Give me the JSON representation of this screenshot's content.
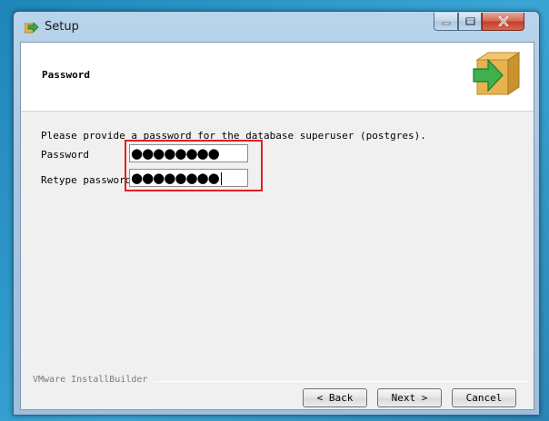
{
  "window": {
    "title": "Setup",
    "controls": {
      "minimize": "–",
      "maximize": "□",
      "close": "✕"
    }
  },
  "header": {
    "title": "Password"
  },
  "form": {
    "description": "Please provide a password for the database superuser (postgres).",
    "password_label": "Password",
    "password_value": "●●●●●●●●",
    "retype_label": "Retype password",
    "retype_value": "●●●●●●●●"
  },
  "footer": {
    "brand": "VMware InstallBuilder",
    "back_label": "< Back",
    "next_label": "Next >",
    "cancel_label": "Cancel"
  },
  "colors": {
    "highlight": "#e02020",
    "titlebar": "#a7c6e2",
    "client_bg": "#f0f0f0"
  },
  "icons": {
    "app": "setup-arrow-icon",
    "header_logo": "box-arrow-icon"
  }
}
